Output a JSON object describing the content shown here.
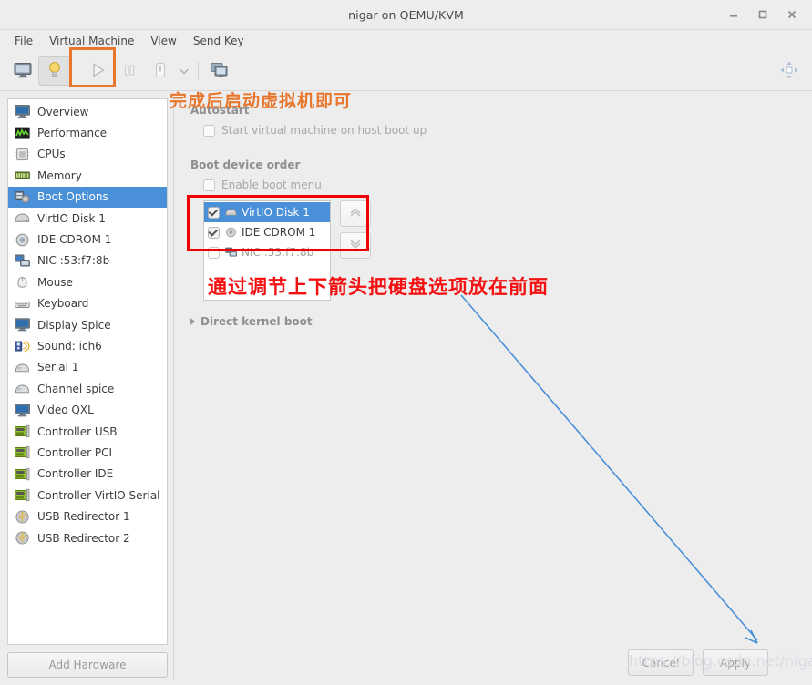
{
  "window": {
    "title": "nigar on QEMU/KVM",
    "controls": [
      {
        "name": "minimize",
        "glyph": "_"
      },
      {
        "name": "maximize",
        "glyph": "□"
      },
      {
        "name": "close",
        "glyph": "✕"
      }
    ]
  },
  "menubar": {
    "items": [
      {
        "label": "File"
      },
      {
        "label": "Virtual Machine"
      },
      {
        "label": "View"
      },
      {
        "label": "Send Key"
      }
    ]
  },
  "toolbar": {
    "buttons": [
      {
        "name": "show-console-button",
        "icon": "monitor-icon",
        "active": false
      },
      {
        "name": "show-details-button",
        "icon": "lightbulb-icon",
        "active": true
      },
      {
        "name": "run-button",
        "icon": "play-icon",
        "active": false
      },
      {
        "name": "pause-button",
        "icon": "pause-icon",
        "active": false
      },
      {
        "name": "shutdown-button",
        "icon": "power-icon",
        "active": false
      },
      {
        "name": "shutdown-menu-button",
        "icon": "chevron-down-icon",
        "active": false
      },
      {
        "name": "snapshots-button",
        "icon": "snapshot-icon",
        "active": false
      }
    ],
    "fullscreen_icon": "fullscreen-icon"
  },
  "sidebar": {
    "items": [
      {
        "label": "Overview",
        "icon": "monitor-icon",
        "selected": false
      },
      {
        "label": "Performance",
        "icon": "chart-icon",
        "selected": false
      },
      {
        "label": "CPUs",
        "icon": "cpu-icon",
        "selected": false
      },
      {
        "label": "Memory",
        "icon": "memory-icon",
        "selected": false
      },
      {
        "label": "Boot Options",
        "icon": "boot-gear-icon",
        "selected": true
      },
      {
        "label": "VirtIO Disk 1",
        "icon": "disk-icon",
        "selected": false
      },
      {
        "label": "IDE CDROM 1",
        "icon": "cdrom-icon",
        "selected": false
      },
      {
        "label": "NIC :53:f7:8b",
        "icon": "network-icon",
        "selected": false
      },
      {
        "label": "Mouse",
        "icon": "mouse-icon",
        "selected": false
      },
      {
        "label": "Keyboard",
        "icon": "keyboard-icon",
        "selected": false
      },
      {
        "label": "Display Spice",
        "icon": "display-icon",
        "selected": false
      },
      {
        "label": "Sound: ich6",
        "icon": "sound-icon",
        "selected": false
      },
      {
        "label": "Serial 1",
        "icon": "serial-icon",
        "selected": false
      },
      {
        "label": "Channel spice",
        "icon": "channel-icon",
        "selected": false
      },
      {
        "label": "Video QXL",
        "icon": "video-icon",
        "selected": false
      },
      {
        "label": "Controller USB",
        "icon": "controller-icon",
        "selected": false
      },
      {
        "label": "Controller PCI",
        "icon": "controller-icon",
        "selected": false
      },
      {
        "label": "Controller IDE",
        "icon": "controller-icon",
        "selected": false
      },
      {
        "label": "Controller VirtIO Serial",
        "icon": "controller-icon",
        "selected": false
      },
      {
        "label": "USB Redirector 1",
        "icon": "usb-icon",
        "selected": false
      },
      {
        "label": "USB Redirector 2",
        "icon": "usb-icon",
        "selected": false
      }
    ],
    "add_hardware_label": "Add Hardware"
  },
  "main": {
    "autostart": {
      "group_label": "Autostart",
      "checkbox_label": "Start virtual machine on host boot up",
      "checked": false
    },
    "boot_device_order": {
      "group_label": "Boot device order",
      "enable_boot_menu_label": "Enable boot menu",
      "enable_boot_menu_checked": false,
      "devices": [
        {
          "label": "VirtIO Disk 1",
          "icon": "disk-icon",
          "checked": true,
          "selected": true
        },
        {
          "label": "IDE CDROM 1",
          "icon": "cdrom-icon",
          "checked": true,
          "selected": false
        },
        {
          "label": "NIC :53:f7:8b",
          "icon": "network-icon",
          "checked": false,
          "selected": false
        }
      ],
      "move_up_label": "Move up",
      "move_down_label": "Move down"
    },
    "direct_kernel_boot_label": "Direct kernel boot",
    "cancel_label": "Cancel",
    "apply_label": "Apply"
  },
  "annotations": {
    "orange_text": "完成后启动虚拟机即可",
    "red_text": "通过调节上下箭头把硬盘选项放在前面",
    "orange_color": "#e8762c",
    "red_color": "#f41010",
    "arrow_color": "#4a90d9",
    "watermark": "https://blog.csdn.net/nigar"
  }
}
